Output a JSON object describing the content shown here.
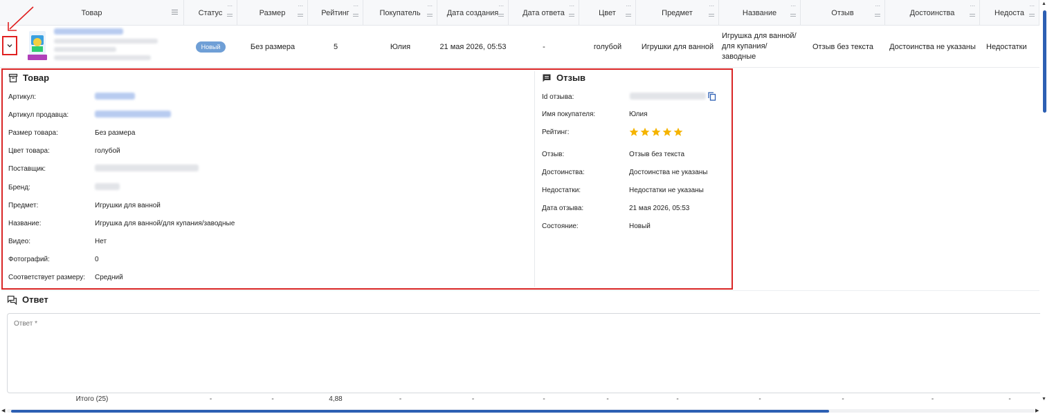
{
  "columns": [
    {
      "label": "Товар",
      "width": 266
    },
    {
      "label": "Статус",
      "width": 77
    },
    {
      "label": "Размер",
      "width": 102
    },
    {
      "label": "Рейтинг",
      "width": 80
    },
    {
      "label": "Покупатель",
      "width": 107
    },
    {
      "label": "Дата создания",
      "width": 103
    },
    {
      "label": "Дата ответа",
      "width": 102
    },
    {
      "label": "Цвет",
      "width": 82
    },
    {
      "label": "Предмет",
      "width": 120
    },
    {
      "label": "Название",
      "width": 118
    },
    {
      "label": "Отзыв",
      "width": 122
    },
    {
      "label": "Достоинства",
      "width": 137
    },
    {
      "label": "Недоста",
      "width": 86
    }
  ],
  "row": {
    "status": "Новый",
    "size": "Без размера",
    "rating": "5",
    "buyer": "Юлия",
    "created": "21 мая 2026, 05:53",
    "answered": "-",
    "color": "голубой",
    "subject": "Игрушки для ванной",
    "name": "Игрушка для ванной/для купания/заводные",
    "review": "Отзыв без текста",
    "pros": "Достоинства не указаны",
    "cons": "Недостатки"
  },
  "product_section": {
    "title": "Товар",
    "fields": [
      {
        "label": "Артикул:",
        "value": "",
        "blurred": true
      },
      {
        "label": "Артикул продавца:",
        "value": "",
        "blurred": true
      },
      {
        "label": "Размер товара:",
        "value": "Без размера"
      },
      {
        "label": "Цвет товара:",
        "value": "голубой"
      },
      {
        "label": "Поставщик:",
        "value": "",
        "blurred": true
      },
      {
        "label": "Бренд:",
        "value": "",
        "blurred": true
      },
      {
        "label": "Предмет:",
        "value": "Игрушки для ванной"
      },
      {
        "label": "Название:",
        "value": "Игрушка для ванной/для купания/заводные"
      },
      {
        "label": "Видео:",
        "value": "Нет"
      },
      {
        "label": "Фотографий:",
        "value": "0"
      },
      {
        "label": "Соответствует размеру:",
        "value": "Средний"
      }
    ]
  },
  "review_section": {
    "title": "Отзыв",
    "id_label": "Id отзыва:",
    "buyer_label": "Имя покупателя:",
    "buyer_value": "Юлия",
    "rating_label": "Рейтинг:",
    "rating_value": 5,
    "review_label": "Отзыв:",
    "review_value": "Отзыв без текста",
    "pros_label": "Достоинства:",
    "pros_value": "Достоинства не указаны",
    "cons_label": "Недостатки:",
    "cons_value": "Недостатки не указаны",
    "date_label": "Дата отзыва:",
    "date_value": "21 мая 2026, 05:53",
    "state_label": "Состояние:",
    "state_value": "Новый"
  },
  "answer": {
    "title": "Ответ",
    "placeholder": "Ответ *"
  },
  "footer": {
    "total_label": "Итого (25)",
    "cells": [
      "-",
      "-",
      "4,88",
      "-",
      "-",
      "-",
      "-",
      "-",
      "-",
      "-",
      "-",
      "-"
    ]
  },
  "colors": {
    "accent": "#2c5fb3",
    "highlight": "#d92525",
    "star": "#f5b400",
    "badge": "#6f9fd6"
  }
}
